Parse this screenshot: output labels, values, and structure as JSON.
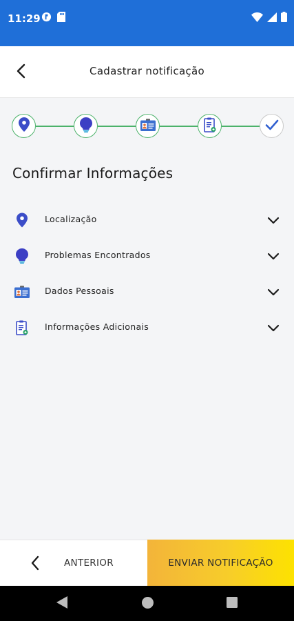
{
  "status_bar": {
    "time": "11:29",
    "left_icons": [
      "data-saver-icon",
      "sd-card-icon"
    ],
    "right_icons": [
      "wifi-icon",
      "signal-icon",
      "battery-icon"
    ]
  },
  "app_bar": {
    "title": "Cadastrar notificação",
    "back_icon": "back-arrow-icon"
  },
  "stepper": {
    "steps": [
      {
        "icon": "location-pin-icon",
        "state": "done"
      },
      {
        "icon": "lightbulb-icon",
        "state": "done"
      },
      {
        "icon": "id-card-icon",
        "state": "done"
      },
      {
        "icon": "clipboard-icon",
        "state": "done"
      },
      {
        "icon": "check-icon",
        "state": "current"
      }
    ],
    "colors": {
      "line": "#4cb26a",
      "accent": "#2f5fd0"
    }
  },
  "section": {
    "title": "Confirmar Informações"
  },
  "info_items": [
    {
      "label": "Localização",
      "icon": "location-pin-icon"
    },
    {
      "label": "Problemas Encontrados",
      "icon": "lightbulb-icon"
    },
    {
      "label": "Dados Pessoais",
      "icon": "id-card-icon"
    },
    {
      "label": "Informações Adicionais",
      "icon": "clipboard-icon"
    }
  ],
  "footer": {
    "previous_label": "ANTERIOR",
    "send_label": "ENVIAR NOTIFICAÇÃO"
  },
  "colors": {
    "status_bar": "#1f6fd8",
    "background": "#f4f5f7",
    "send_gradient": [
      "#f3b43a",
      "#fde200"
    ]
  }
}
